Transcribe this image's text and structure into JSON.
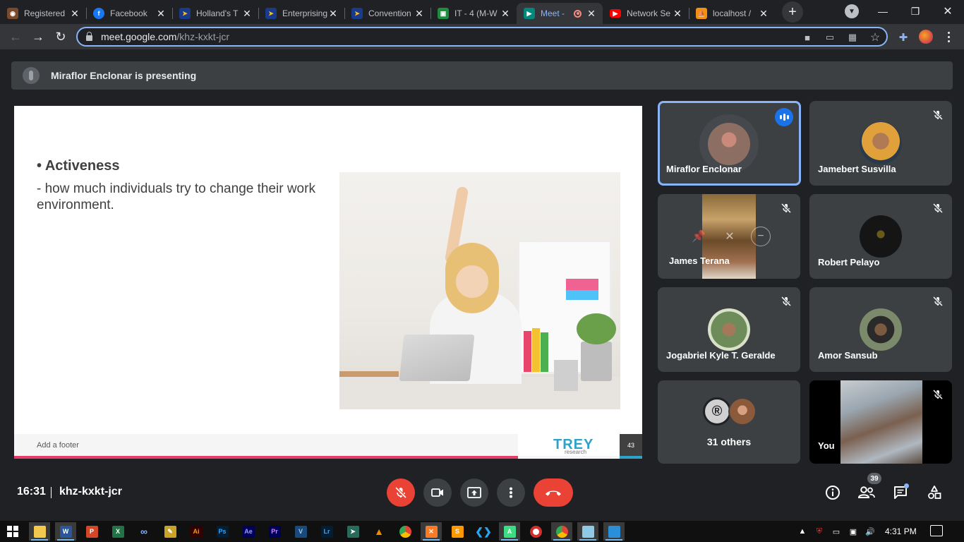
{
  "browser": {
    "tabs": [
      {
        "title": "Registered",
        "favicon": "globe-icon",
        "color": "#7a4a2a"
      },
      {
        "title": "Facebook",
        "favicon": "facebook-icon",
        "color": "#1877f2"
      },
      {
        "title": "Holland's T",
        "favicon": "slides-icon",
        "color": "#1a3a8a"
      },
      {
        "title": "Enterprising",
        "favicon": "slides-icon",
        "color": "#1a3a8a"
      },
      {
        "title": "Convention",
        "favicon": "slides-icon",
        "color": "#1a3a8a"
      },
      {
        "title": "IT - 4 (M-W",
        "favicon": "classroom-icon",
        "color": "#1e8e3e"
      },
      {
        "title": "Meet -",
        "favicon": "meet-icon",
        "color": "#00897b",
        "active": true,
        "recording": true
      },
      {
        "title": "Network Se",
        "favicon": "youtube-icon",
        "color": "#ff0000"
      },
      {
        "title": "localhost /",
        "favicon": "phpmyadmin-icon",
        "color": "#f29111"
      }
    ],
    "url_host": "meet.google.com",
    "url_path": "/khz-kxkt-jcr"
  },
  "banner": {
    "text": "Miraflor Enclonar is presenting"
  },
  "slide": {
    "bullet_title": "Activeness",
    "bullet_text": " - how much individuals try to change their work environment.",
    "footer": "Add a footer",
    "logo_main": "TREY",
    "logo_sub": "research",
    "page_number": "43"
  },
  "participants": [
    {
      "name": "Miraflor Enclonar",
      "speaking": true,
      "avatar_color": "#8d6e63"
    },
    {
      "name": "Jamebert Susvilla",
      "muted": true,
      "avatar_color": "#e0a03a"
    },
    {
      "name": "James Terana",
      "muted": true,
      "video": true
    },
    {
      "name": "Robert Pelayo",
      "muted": true,
      "avatar_color": "#151515"
    },
    {
      "name": "Jogabriel Kyle T. Geralde",
      "muted": true,
      "avatar_color": "#6d8c5a"
    },
    {
      "name": "Amor Sansub",
      "muted": true,
      "avatar_color": "#7a8a6a"
    },
    {
      "name": "31 others"
    },
    {
      "name": "You",
      "muted": true,
      "video": true
    }
  ],
  "meeting": {
    "time": "16:31",
    "code": "khz-kxkt-jcr",
    "people_count": "39"
  },
  "taskbar": {
    "time": "4:31 PM"
  },
  "colors": {
    "meet_bg": "#202124",
    "tile_bg": "#3c4043",
    "red": "#ea4335",
    "accent_blue": "#8ab4f8",
    "slide_pink": "#e33e6a",
    "trey_blue": "#2ea3c7"
  }
}
